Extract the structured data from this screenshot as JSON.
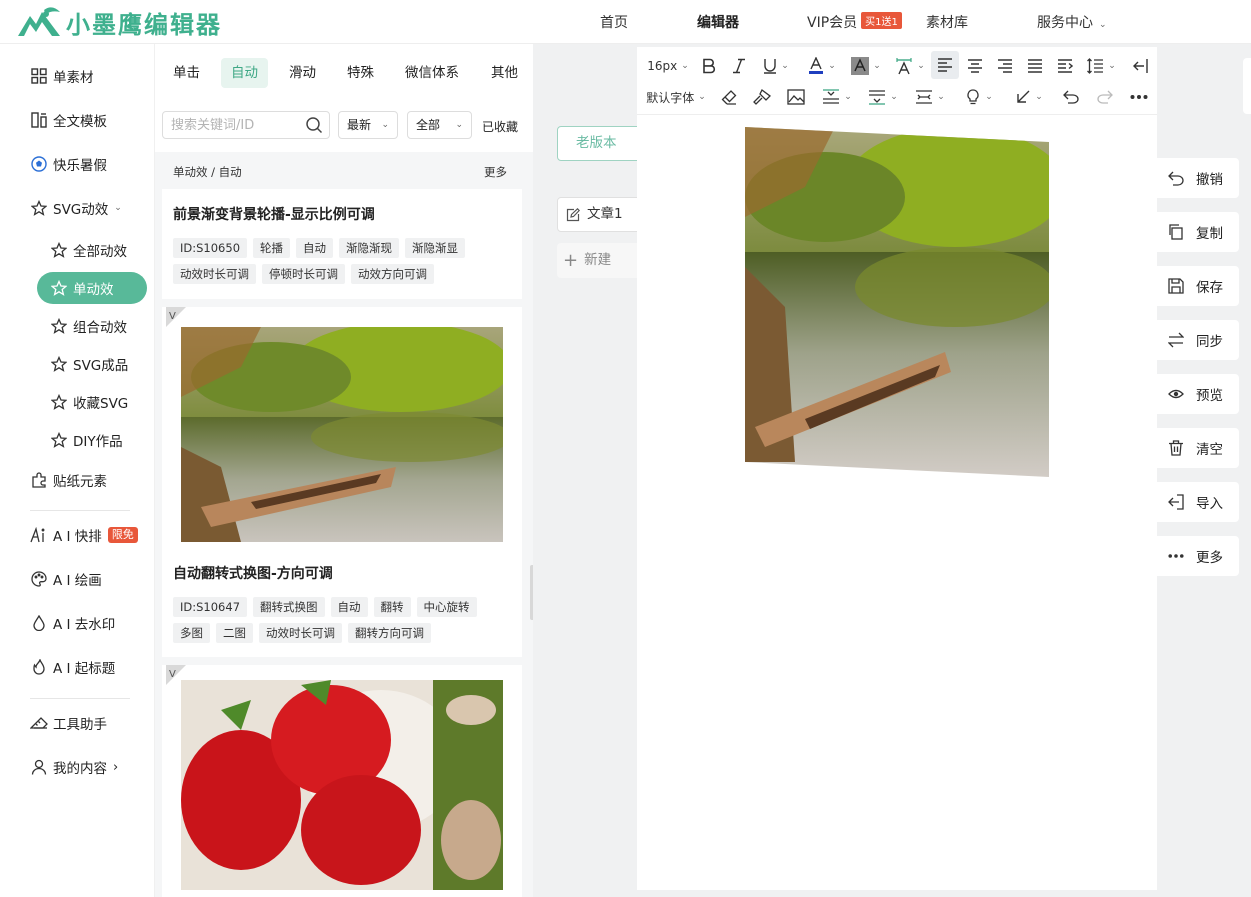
{
  "brand": {
    "name": "小墨鹰编辑器",
    "color": "#3fb08e"
  },
  "nav": {
    "home": "首页",
    "editor": "编辑器",
    "vip": "VIP会员",
    "vip_badge": "买1送1",
    "assets": "素材库",
    "service": "服务中心"
  },
  "sidebar": {
    "items": [
      {
        "label": "单素材",
        "icon": "grid-icon"
      },
      {
        "label": "全文模板",
        "icon": "template-icon"
      },
      {
        "label": "快乐暑假",
        "icon": "football-icon"
      },
      {
        "label": "SVG动效",
        "icon": "star-icon"
      },
      {
        "label": "全部动效",
        "icon": "star-icon"
      },
      {
        "label": "单动效",
        "icon": "star-icon"
      },
      {
        "label": "组合动效",
        "icon": "star-icon"
      },
      {
        "label": "SVG成品",
        "icon": "star-icon"
      },
      {
        "label": "收藏SVG",
        "icon": "star-icon"
      },
      {
        "label": "DIY作品",
        "icon": "star-icon"
      },
      {
        "label": "贴纸元素",
        "icon": "puzzle-icon"
      },
      {
        "label": "A I 快排",
        "icon": "ai-icon",
        "badge": "限免"
      },
      {
        "label": "A I 绘画",
        "icon": "palette-icon"
      },
      {
        "label": "A I 去水印",
        "icon": "drop-icon"
      },
      {
        "label": "A I 起标题",
        "icon": "flame-icon"
      },
      {
        "label": "工具助手",
        "icon": "ruler-icon"
      },
      {
        "label": "我的内容",
        "icon": "user-icon"
      }
    ],
    "active_color": "#58b999"
  },
  "panel": {
    "tabs": [
      "单击",
      "自动",
      "滑动",
      "特殊",
      "微信体系",
      "其他"
    ],
    "active_tab": "自动",
    "search_placeholder": "搜索关键词/ID",
    "sort": "最新",
    "scope": "全部",
    "favorites": "已收藏",
    "breadcrumb": "单动效 / 自动",
    "more": "更多",
    "cards": [
      {
        "title": "前景渐变背景轮播-显示比例可调",
        "tags_row1": [
          "ID:S10650",
          "轮播",
          "自动",
          "渐隐渐现",
          "渐隐渐显"
        ],
        "tags_row2": [
          "动效时长可调",
          "停顿时长可调",
          "动效方向可调"
        ]
      },
      {
        "title": "自动翻转式换图-方向可调",
        "tags_row1": [
          "ID:S10647",
          "翻转式换图",
          "自动",
          "翻转",
          "中心旋转"
        ],
        "tags_row2": [
          "多图",
          "二图",
          "动效时长可调",
          "翻转方向可调"
        ]
      }
    ]
  },
  "workspace": {
    "old_version": "老版本",
    "article": "文章1",
    "new_article": "新建"
  },
  "toolbar": {
    "font_size": "16px",
    "font_family": "默认字体"
  },
  "actions": [
    {
      "label": "撤销",
      "icon": "undo-icon"
    },
    {
      "label": "复制",
      "icon": "copy-icon"
    },
    {
      "label": "保存",
      "icon": "save-icon"
    },
    {
      "label": "同步",
      "icon": "sync-icon"
    },
    {
      "label": "预览",
      "icon": "eye-icon"
    },
    {
      "label": "清空",
      "icon": "trash-icon"
    },
    {
      "label": "导入",
      "icon": "import-icon"
    },
    {
      "label": "更多",
      "icon": "more-icon"
    }
  ]
}
